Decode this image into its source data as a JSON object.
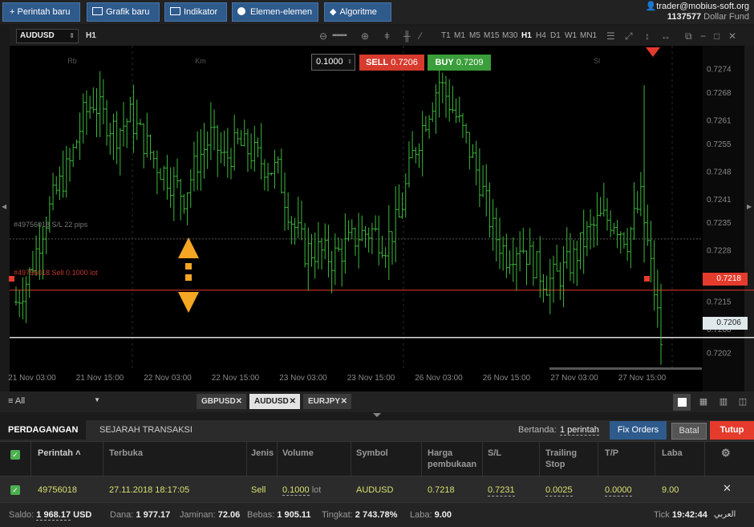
{
  "toolbar": {
    "new_order": "+ Perintah baru",
    "new_chart": "Grafik baru",
    "indicators": "Indikator",
    "elements": "Elemen-elemen",
    "algorithms": "Algoritme"
  },
  "account": {
    "email": "trader@mobius-soft.org",
    "number": "1137577",
    "fund": "Dollar Fund"
  },
  "chart_toolbar": {
    "symbol": "AUDUSD",
    "timeframe": "H1",
    "timeframes": [
      "T1",
      "M1",
      "M5",
      "M15",
      "M30",
      "H1",
      "H4",
      "D1",
      "W1",
      "MN1"
    ],
    "active_timeframe": "H1"
  },
  "trade_panel": {
    "volume": "0.1000",
    "sell_label": "SELL",
    "sell_price": "0.7206",
    "buy_label": "BUY",
    "buy_price": "0.7209"
  },
  "day_labels": [
    "Rb",
    "Km",
    "Sl"
  ],
  "order_lines": {
    "sl_label": "#49756018 S/L 22 pips",
    "order_label": "#49756018 Sell 0.1000 lot",
    "order_price": "0.7218",
    "bid_price": "0.7206"
  },
  "chart_data": {
    "type": "bar",
    "symbol": "AUDUSD",
    "timeframe": "H1",
    "y_ticks": [
      "0.7274",
      "0.7268",
      "0.7261",
      "0.7255",
      "0.7248",
      "0.7241",
      "0.7235",
      "0.7228",
      "0.7221",
      "0.7215",
      "0.7208",
      "0.7202"
    ],
    "x_ticks": [
      "21 Nov 03:00",
      "21 Nov 15:00",
      "22 Nov 03:00",
      "22 Nov 15:00",
      "23 Nov 03:00",
      "23 Nov 15:00",
      "26 Nov 03:00",
      "26 Nov 15:00",
      "27 Nov 03:00",
      "27 Nov 15:00"
    ],
    "ylim": [
      0.7198,
      0.7278
    ],
    "close_path": [
      [
        0,
        0.7215
      ],
      [
        4,
        0.7222
      ],
      [
        8,
        0.7234
      ],
      [
        12,
        0.7243
      ],
      [
        16,
        0.725
      ],
      [
        20,
        0.7262
      ],
      [
        23,
        0.7266
      ],
      [
        26,
        0.7262
      ],
      [
        30,
        0.7258
      ],
      [
        34,
        0.7262
      ],
      [
        38,
        0.7256
      ],
      [
        42,
        0.725
      ],
      [
        46,
        0.7246
      ],
      [
        50,
        0.7242
      ],
      [
        54,
        0.7251
      ],
      [
        58,
        0.7257
      ],
      [
        62,
        0.7251
      ],
      [
        66,
        0.7255
      ],
      [
        70,
        0.7253
      ],
      [
        74,
        0.725
      ],
      [
        78,
        0.7248
      ],
      [
        82,
        0.7236
      ],
      [
        86,
        0.7228
      ],
      [
        90,
        0.7228
      ],
      [
        94,
        0.7226
      ],
      [
        98,
        0.7229
      ],
      [
        102,
        0.7232
      ],
      [
        106,
        0.7233
      ],
      [
        110,
        0.723
      ],
      [
        114,
        0.7236
      ],
      [
        118,
        0.7252
      ],
      [
        122,
        0.7262
      ],
      [
        126,
        0.7271
      ],
      [
        130,
        0.7264
      ],
      [
        134,
        0.7256
      ],
      [
        138,
        0.7246
      ],
      [
        142,
        0.7233
      ],
      [
        146,
        0.7227
      ],
      [
        150,
        0.723
      ],
      [
        154,
        0.7225
      ],
      [
        158,
        0.722
      ],
      [
        162,
        0.7222
      ],
      [
        166,
        0.7226
      ],
      [
        170,
        0.7232
      ],
      [
        174,
        0.7236
      ],
      [
        178,
        0.7236
      ],
      [
        182,
        0.7231
      ],
      [
        186,
        0.7241
      ],
      [
        190,
        0.7218
      ],
      [
        192,
        0.7205
      ]
    ]
  },
  "symbol_tabs": {
    "all_label": "All",
    "tabs": [
      "GBPUSD",
      "AUDUSD",
      "EURJPY"
    ],
    "active": "AUDUSD"
  },
  "bottom": {
    "tab_trading": "PERDAGANGAN",
    "tab_history": "SEJARAH TRANSAKSI",
    "marked_label": "Bertanda:",
    "marked_value": "1 perintah",
    "fix_orders": "Fix Orders",
    "cancel": "Batal",
    "close": "Tutup",
    "columns": [
      "Perintah ˄",
      "Terbuka",
      "Jenis",
      "Volume",
      "Symbol",
      "Harga pembukaan",
      "S/L",
      "Trailing Stop",
      "T/P",
      "Laba"
    ],
    "row": {
      "order": "49756018",
      "opened": "27.11.2018 18:17:05",
      "type": "Sell",
      "volume": "0.1000",
      "volume_unit": "lot",
      "symbol": "AUDUSD",
      "open_price": "0.7218",
      "sl": "0.7231",
      "trailing": "0.0025",
      "tp": "0.0000",
      "profit": "9.00"
    }
  },
  "status": {
    "saldo_label": "Saldo:",
    "saldo": "1 968.17",
    "saldo_unit": "USD",
    "dana_label": "Dana:",
    "dana": "1 977.17",
    "jaminan_label": "Jaminan:",
    "jaminan": "72.06",
    "bebas_label": "Bebas:",
    "bebas": "1 905.11",
    "tingkat_label": "Tingkat:",
    "tingkat": "2 743.78%",
    "laba_label": "Laba:",
    "laba": "9.00",
    "tick_label": "Tick",
    "time": "19:42:44",
    "lang": "العربي"
  },
  "colors": {
    "accent": "#2e5a8c",
    "sell": "#d63b2e",
    "buy": "#3a9e3a",
    "candle": "#3db83d",
    "close": "#e04a2f"
  }
}
